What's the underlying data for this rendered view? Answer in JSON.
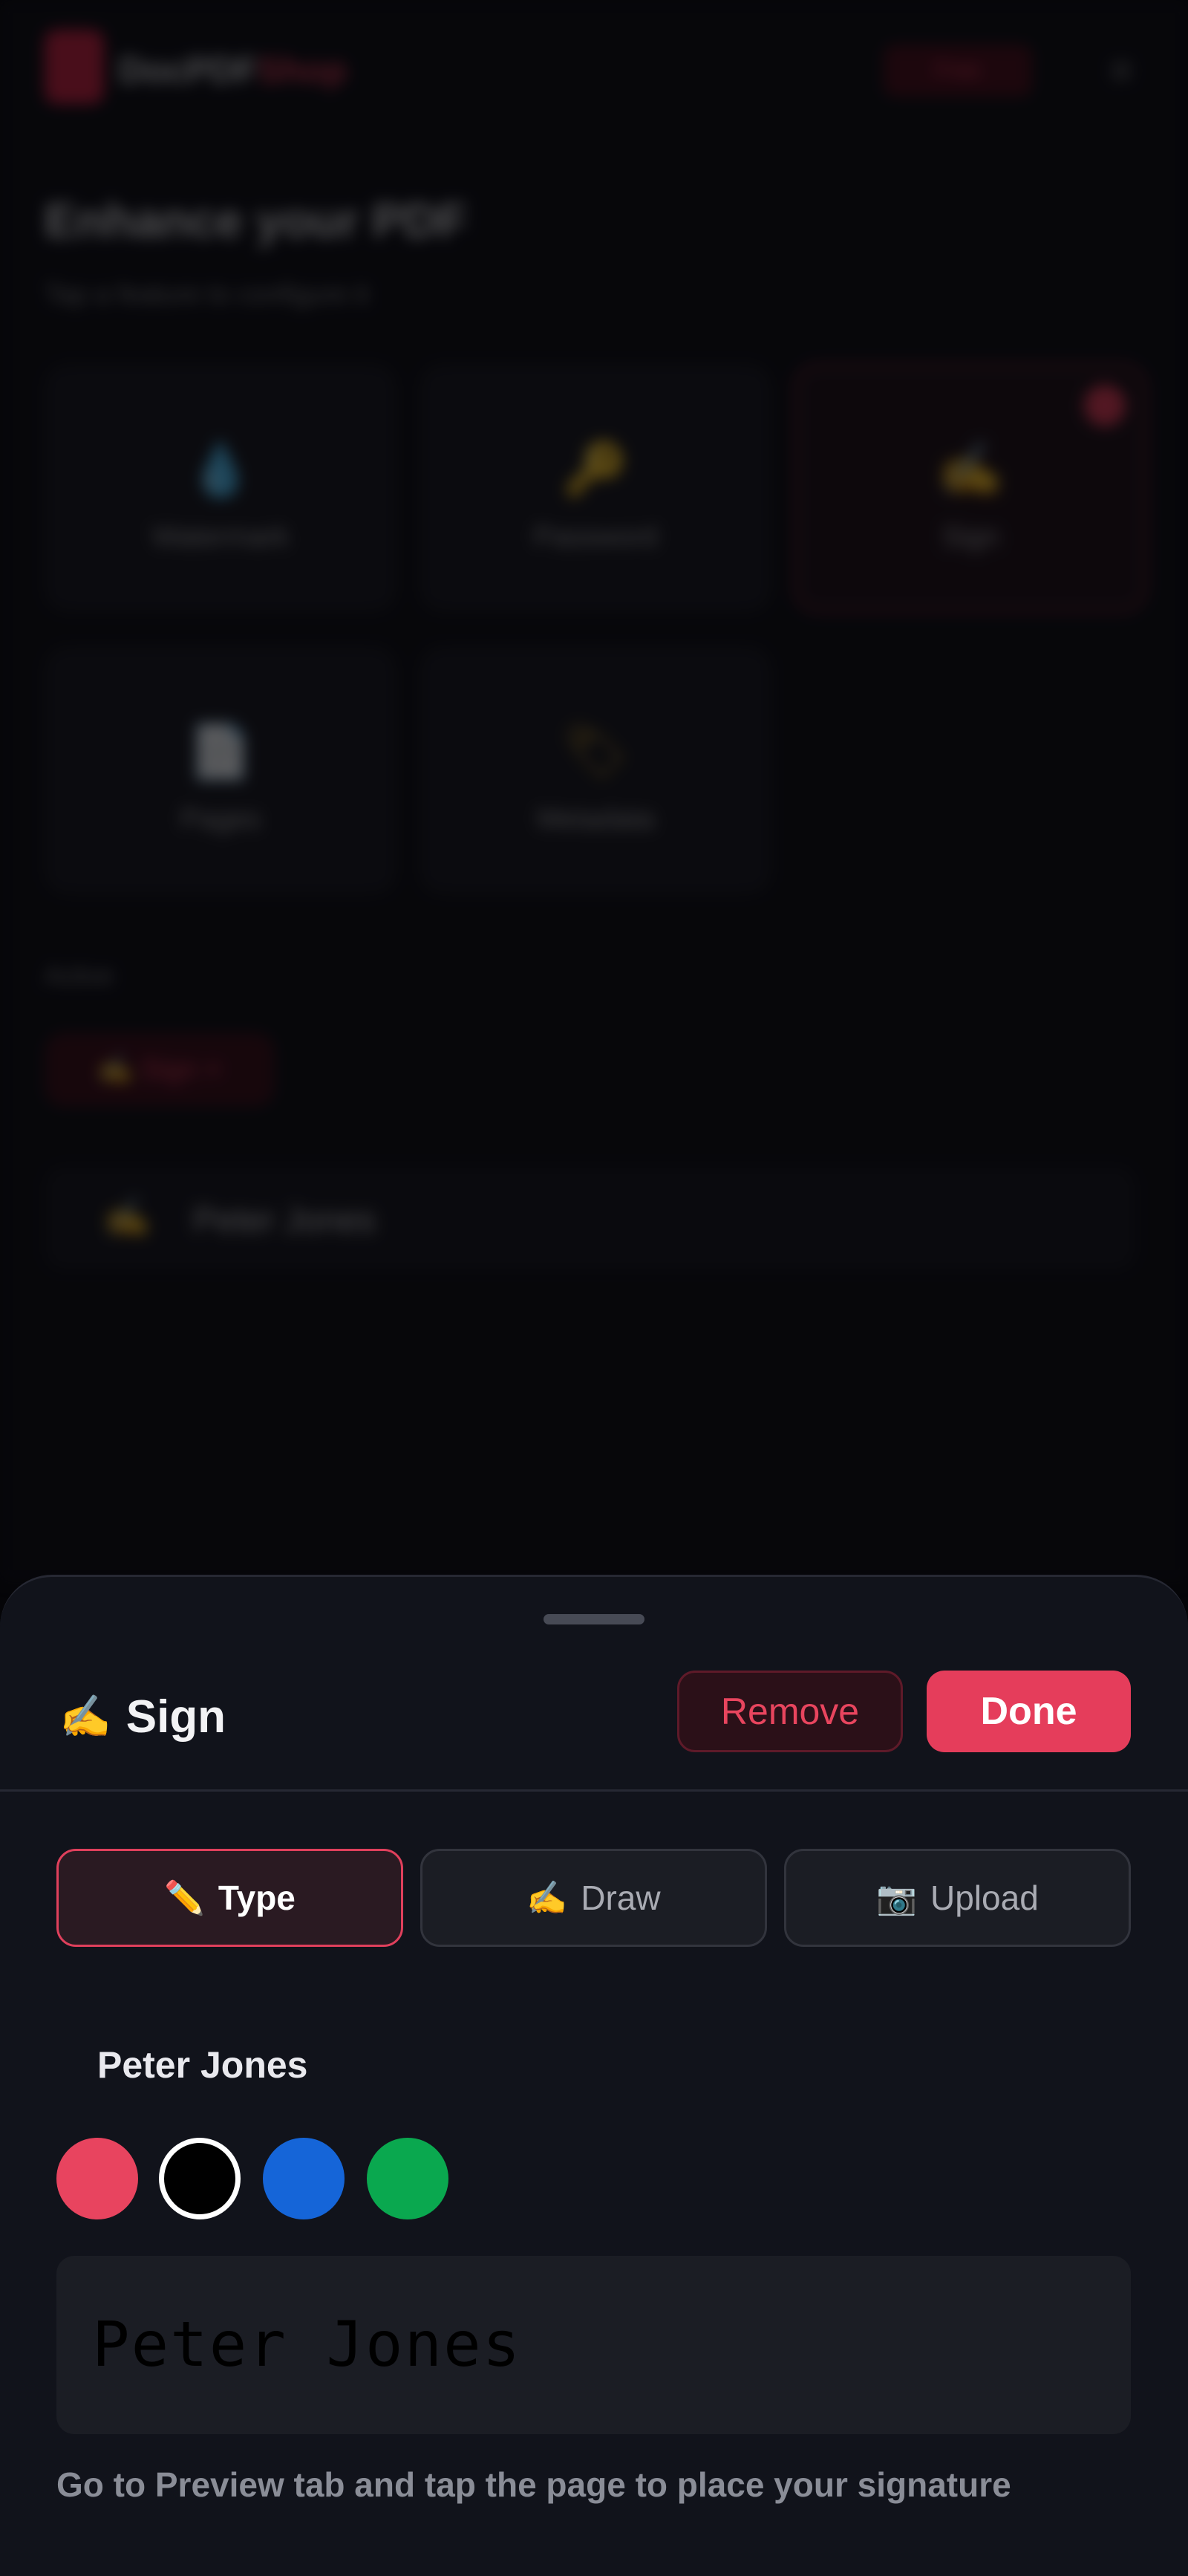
{
  "background_app": {
    "brand_first": "DocPDF",
    "brand_second": "Shop",
    "header_pill": "Free",
    "menu_icon": "≡",
    "heading": "Enhance your PDF",
    "subheading": "Tap a feature to configure it",
    "cards": [
      {
        "icon": "💧",
        "label": "Watermark"
      },
      {
        "icon": "🔑",
        "label": "Password"
      },
      {
        "icon": "✍️",
        "label": "Sign"
      },
      {
        "icon": "📄",
        "label": "Pages"
      },
      {
        "icon": "🏷",
        "label": "Metadata"
      }
    ],
    "section_label": "Active",
    "active_chip": "✍️ Sign ×",
    "row_icon": "✍️",
    "row_text": "Peter Jones"
  },
  "sheet": {
    "title_icon": "✍️",
    "title": "Sign",
    "remove_label": "Remove",
    "done_label": "Done",
    "tabs": [
      {
        "icon": "✏️",
        "label": "Type",
        "active": true
      },
      {
        "icon": "✍️",
        "label": "Draw",
        "active": false
      },
      {
        "icon": "📷",
        "label": "Upload",
        "active": false
      }
    ],
    "name_value": "Peter Jones",
    "colors": [
      {
        "name": "red",
        "hex": "#e8445f",
        "selected": false
      },
      {
        "name": "black",
        "hex": "#000000",
        "selected": true
      },
      {
        "name": "blue",
        "hex": "#1565d8",
        "selected": false
      },
      {
        "name": "green",
        "hex": "#0aa84f",
        "selected": false
      }
    ],
    "signature_preview": "Peter Jones",
    "hint": "Go to Preview tab and tap the page to place your signature"
  }
}
